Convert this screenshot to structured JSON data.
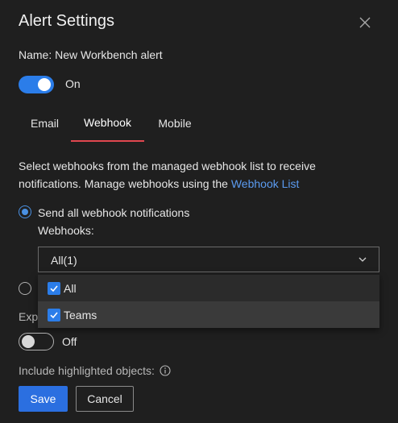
{
  "dialog": {
    "title": "Alert Settings",
    "name_label": "Name: New Workbench alert"
  },
  "enabled_toggle": {
    "state": "on",
    "label": "On"
  },
  "tabs": [
    {
      "label": "Email",
      "active": false
    },
    {
      "label": "Webhook",
      "active": true
    },
    {
      "label": "Mobile",
      "active": false
    }
  ],
  "webhook": {
    "description": "Select webhooks from the managed webhook list to receive notifications. Manage webhooks using the ",
    "link_text": "Webhook List",
    "send_all_label": "Send all webhook notifications",
    "send_all_selected": true,
    "webhooks_label": "Webhooks:",
    "select_value": "All(1)",
    "options": [
      {
        "label": "All",
        "checked": true
      },
      {
        "label": "Teams",
        "checked": true
      }
    ],
    "second_option_selected": false
  },
  "expand": {
    "label_partial": "Expa",
    "toggle_state": "off",
    "toggle_label": "Off"
  },
  "include_label": "Include highlighted objects:",
  "buttons": {
    "save": "Save",
    "cancel": "Cancel"
  },
  "colors": {
    "accent": "#2b7de9",
    "tab_underline": "#e0474f",
    "link": "#5b9bf0",
    "background": "#1f1f1f"
  }
}
